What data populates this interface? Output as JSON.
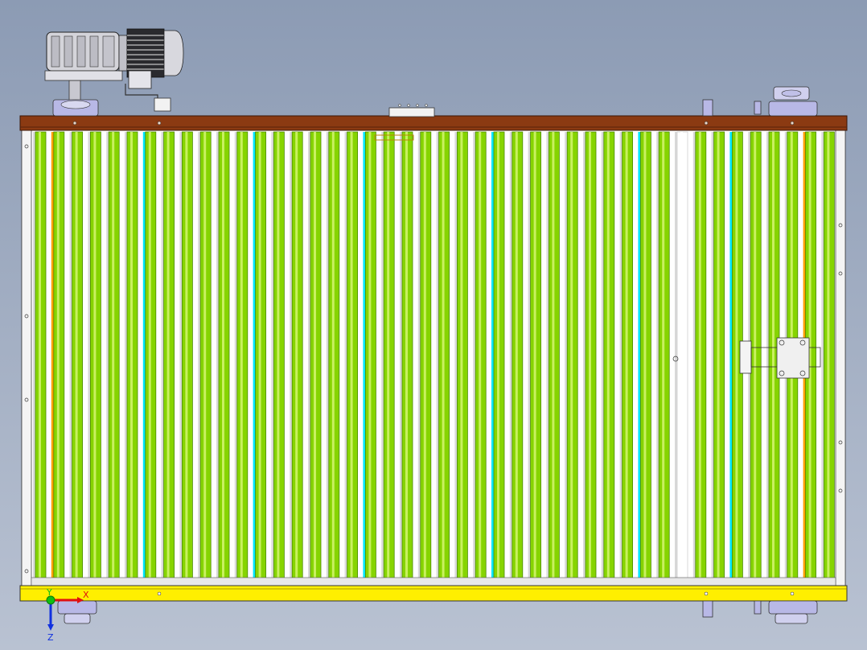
{
  "colors": {
    "background_top": "#8c9bb4",
    "background_bottom": "#b9c2d2",
    "top_rail": "#8b3a12",
    "bottom_rail": "#ffef00",
    "frame": "#ffffff",
    "roller_green": "#86d400",
    "roller_green_dark": "#4a8a00",
    "roller_cyan": "#00e6ff",
    "roller_orange": "#ff9f00",
    "motor_gray": "#c9c9cf",
    "motor_dark": "#5a5a60",
    "bearing_blue": "#b8b8e6",
    "axis_x": "#e01010",
    "axis_y": "#10c010",
    "axis_z": "#1030e0"
  },
  "triad": {
    "x_label": "X",
    "y_label": "Y",
    "z_label": "Z"
  }
}
